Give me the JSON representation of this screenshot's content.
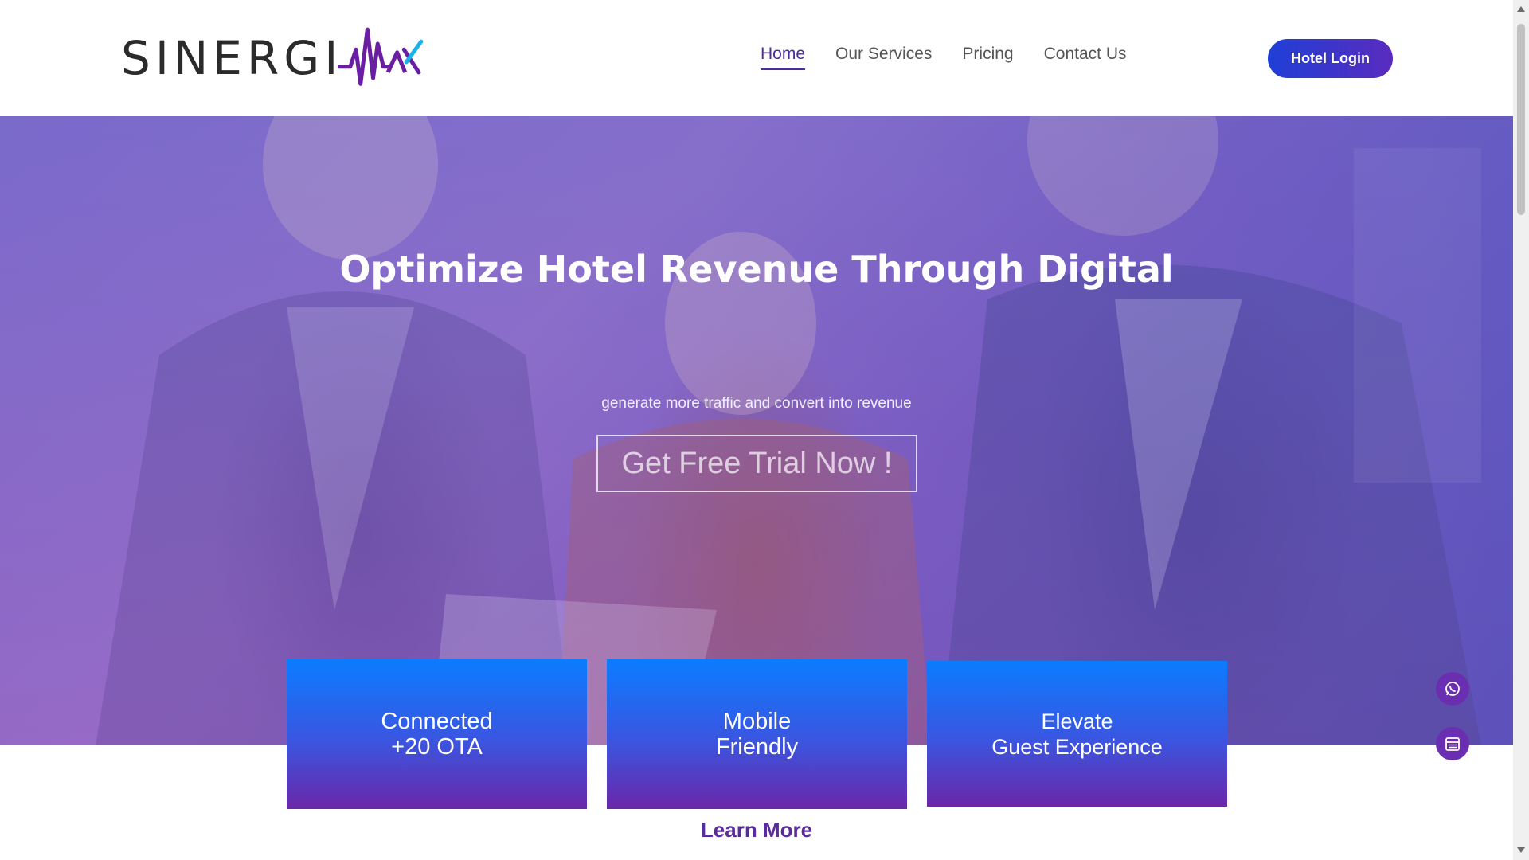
{
  "header": {
    "logo_text": "SINERGI",
    "nav": [
      {
        "label": "Home",
        "active": true
      },
      {
        "label": "Our Services",
        "active": false
      },
      {
        "label": "Pricing",
        "active": false
      },
      {
        "label": "Contact Us",
        "active": false
      }
    ],
    "login_label": "Hotel Login"
  },
  "hero": {
    "title": "Optimize Hotel Revenue Through Digital",
    "subtitle": "generate more traffic and convert into revenue",
    "cta_label": "Get Free Trial Now !"
  },
  "features": [
    {
      "line1": "Connected",
      "line2": "+20 OTA"
    },
    {
      "line1": "Mobile",
      "line2": "Friendly"
    },
    {
      "line1": "Elevate",
      "line2": "Guest Experience"
    }
  ],
  "learn_more_label": "Learn More",
  "floating": [
    {
      "icon": "whatsapp-icon"
    },
    {
      "icon": "calendar-icon"
    }
  ],
  "colors": {
    "brand_purple": "#5a2b9c",
    "brand_blue": "#1f3fd6",
    "card_top": "#0b7cff",
    "card_bottom": "#6a27a8"
  }
}
